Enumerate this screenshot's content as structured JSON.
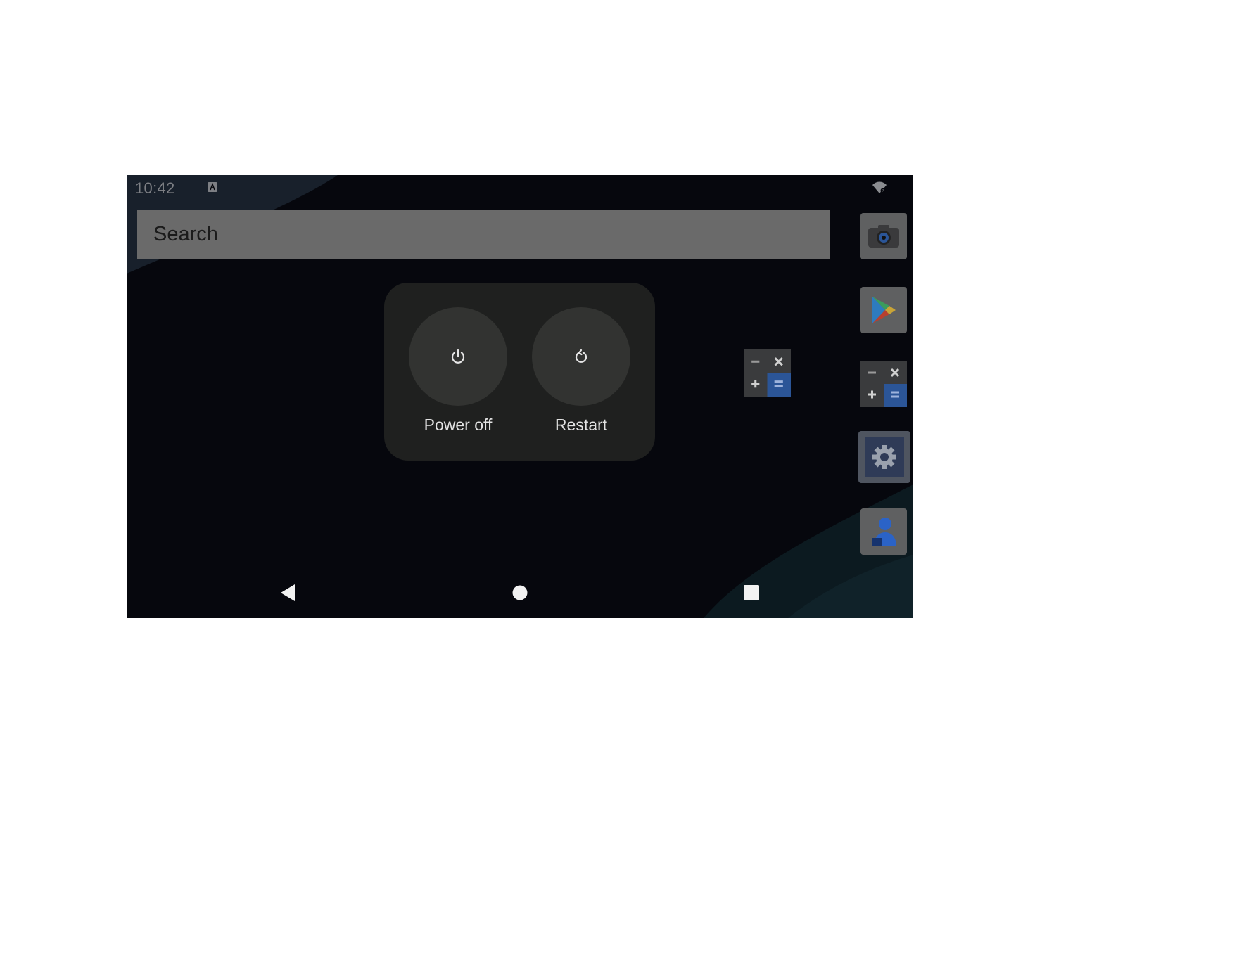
{
  "status_bar": {
    "time": "10:42",
    "notification_icon": "notification-a-icon",
    "wifi_icon": "wifi-icon"
  },
  "search": {
    "placeholder": "Search"
  },
  "power_menu": {
    "options": [
      {
        "label": "Power off",
        "icon": "power-icon"
      },
      {
        "label": "Restart",
        "icon": "restart-icon"
      }
    ]
  },
  "dock": {
    "apps": [
      "camera-icon",
      "play-store-icon",
      "calculator-icon",
      "settings-icon",
      "contacts-icon"
    ]
  },
  "home_widgets": [
    "calculator-icon"
  ],
  "navigation": [
    "back-icon",
    "home-icon",
    "recents-icon"
  ],
  "colors": {
    "background": "#06070d",
    "scrim_gray": "#6a6a6a",
    "dialog": "#1f201f",
    "button": "#323331",
    "accent_blue": "#2b5597"
  }
}
